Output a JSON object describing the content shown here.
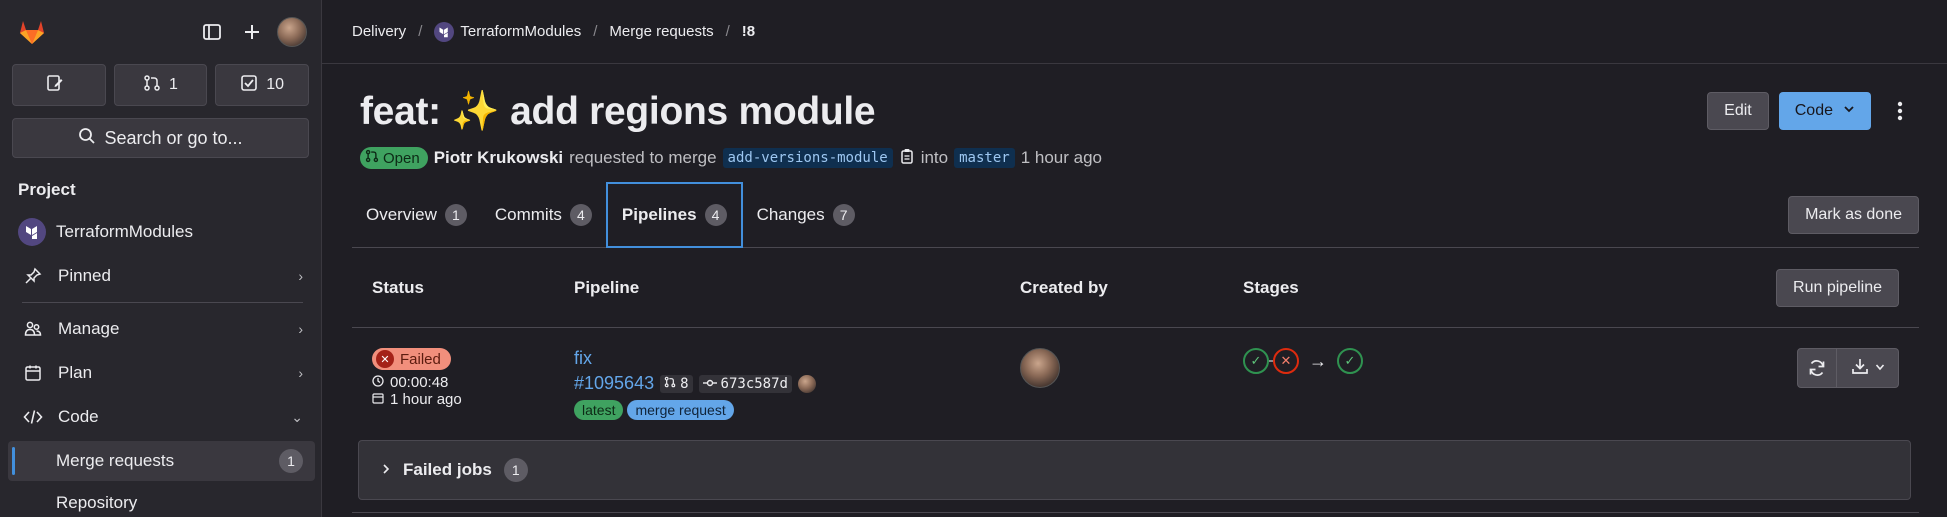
{
  "sidebar": {
    "counters": [
      {
        "icon": "edit-icon",
        "value": ""
      },
      {
        "icon": "merge-request-icon",
        "value": "1"
      },
      {
        "icon": "todo-icon",
        "value": "10"
      }
    ],
    "search_label": "Search or go to...",
    "section_title": "Project",
    "project_name": "TerraformModules",
    "items": [
      {
        "label": "Pinned",
        "icon": "pin-icon"
      },
      {
        "label": "Manage",
        "icon": "users-icon"
      },
      {
        "label": "Plan",
        "icon": "calendar-icon"
      },
      {
        "label": "Code",
        "icon": "code-icon"
      }
    ],
    "sub_items": [
      {
        "label": "Merge requests",
        "count": "1"
      },
      {
        "label": "Repository"
      }
    ]
  },
  "breadcrumb": {
    "group": "Delivery",
    "project": "TerraformModules",
    "section": "Merge requests",
    "current": "!8"
  },
  "mr": {
    "title": "feat: ✨ add regions module",
    "status": "Open",
    "author": "Piotr Krukowski",
    "requested_text": "requested to merge",
    "source_branch": "add-versions-module",
    "into_text": "into",
    "target_branch": "master",
    "time": "1 hour ago",
    "edit_label": "Edit",
    "code_label": "Code",
    "mark_done_label": "Mark as done"
  },
  "tabs": [
    {
      "label": "Overview",
      "count": "1"
    },
    {
      "label": "Commits",
      "count": "4"
    },
    {
      "label": "Pipelines",
      "count": "4"
    },
    {
      "label": "Changes",
      "count": "7"
    }
  ],
  "pipelines": {
    "headers": {
      "status": "Status",
      "pipeline": "Pipeline",
      "created_by": "Created by",
      "stages": "Stages"
    },
    "run_label": "Run pipeline",
    "row": {
      "status": "Failed",
      "duration": "00:00:48",
      "finished": "1 hour ago",
      "name": "fix",
      "id": "#1095643",
      "mr_ref": "8",
      "commit": "673c587d",
      "tags": [
        "latest",
        "merge request"
      ]
    },
    "failed_jobs_label": "Failed jobs",
    "failed_jobs_count": "1"
  },
  "colors": {
    "accent": "#428fdc",
    "confirm": "#63a6e9",
    "success": "#3fa260",
    "danger": "#dd2b0e"
  }
}
